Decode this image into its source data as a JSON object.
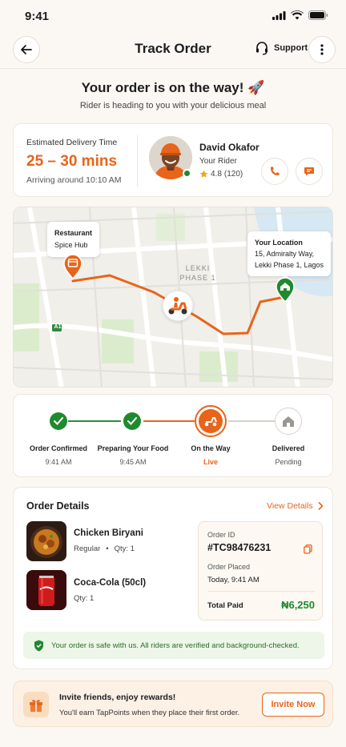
{
  "status_bar": {
    "time": "9:41"
  },
  "header": {
    "title": "Track Order",
    "support_label": "Support"
  },
  "hero": {
    "title": "Your order is on the way! 🚀",
    "subtitle": "Rider is heading to you with your delicious meal"
  },
  "delivery": {
    "label": "Estimated Delivery Time",
    "eta": "25 – 30 mins",
    "arriving": "Arriving around 10:10 AM"
  },
  "rider": {
    "name": "David Okafor",
    "role": "Your Rider",
    "rating": "4.8",
    "reviews": "(120)"
  },
  "map": {
    "restaurant_title": "Restaurant",
    "restaurant_name": "Spice Hub",
    "area_line1": "LEKKI",
    "area_line2": "PHASE 1",
    "road_tag": "A1",
    "location_title": "Your Location",
    "location_line1": "15, Admiralty Way,",
    "location_line2": "Lekki Phase 1, Lagos"
  },
  "steps": [
    {
      "label": "Order Confirmed",
      "sub": "9:41 AM",
      "state": "done"
    },
    {
      "label": "Preparing Your Food",
      "sub": "9:45 AM",
      "state": "done"
    },
    {
      "label": "On the Way",
      "sub": "Live",
      "state": "active"
    },
    {
      "label": "Delivered",
      "sub": "Pending",
      "state": "pending"
    }
  ],
  "order": {
    "title": "Order Details",
    "view_details": "View Details",
    "items": [
      {
        "name": "Chicken Biryani",
        "variant": "Regular",
        "sep": "•",
        "qty": "Qty: 1"
      },
      {
        "name": "Coca-Cola (50cl)",
        "qty": "Qty: 1"
      }
    ],
    "summary": {
      "order_id_label": "Order ID",
      "order_id": "#TC98476231",
      "placed_label": "Order Placed",
      "placed": "Today, 9:41 AM",
      "total_label": "Total Paid",
      "total": "₦6,250"
    },
    "safety": "Your order is safe with us. All riders are verified and background-checked."
  },
  "invite": {
    "title": "Invite friends, enjoy rewards!",
    "subtitle": "You'll earn TapPoints when they place their first order.",
    "button": "Invite Now"
  },
  "colors": {
    "accent": "#e8641a",
    "success": "#1f8a2e",
    "background": "#fbf8f4"
  }
}
